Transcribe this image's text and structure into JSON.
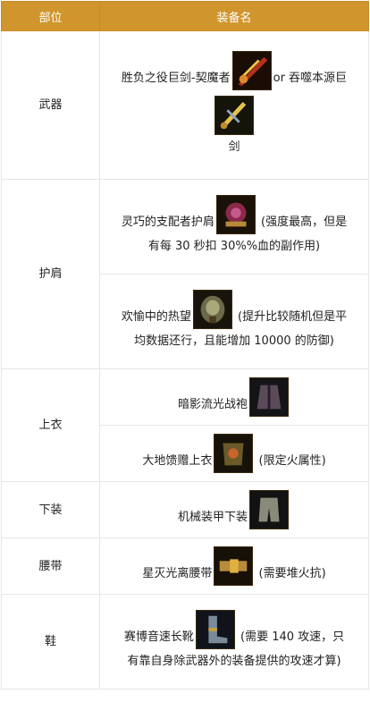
{
  "header": {
    "part": "部位",
    "equip": "装备名"
  },
  "rows": [
    {
      "part": "武器",
      "items": [
        {
          "line1": "胜负之役巨剑-契魔者",
          "mid": "or 吞噬本源巨",
          "line2": "剑",
          "icon": "sword-icon"
        }
      ]
    },
    {
      "part": "护肩",
      "items": [
        {
          "text": "灵巧的支配者护肩",
          "note1": "(强度最高，但是",
          "note2": "有每 30 秒扣 30%%血的副作用)",
          "icon": "shoulder-icon"
        },
        {
          "text": "欢愉中的热望",
          "note1": "(提升比较随机但是平",
          "note2": "均数据还行，且能增加 10000 的防御)",
          "icon": "shoulder2-icon"
        }
      ]
    },
    {
      "part": "上衣",
      "items": [
        {
          "text": "暗影流光战袍",
          "icon": "robe-icon"
        },
        {
          "text": "大地馈赠上衣",
          "note1": "(限定火属性)",
          "icon": "coat-icon"
        }
      ]
    },
    {
      "part": "下装",
      "items": [
        {
          "text": "机械装甲下装",
          "icon": "pants-icon"
        }
      ]
    },
    {
      "part": "腰带",
      "items": [
        {
          "text": "星灭光离腰带",
          "note1": "(需要堆火抗)",
          "icon": "belt-icon"
        }
      ]
    },
    {
      "part": "鞋",
      "items": [
        {
          "text": "赛博音速长靴",
          "note1": "(需要 140 攻速，只",
          "note2": "有靠自身除武器外的装备提供的攻速才算)",
          "icon": "boots-icon"
        }
      ]
    }
  ]
}
